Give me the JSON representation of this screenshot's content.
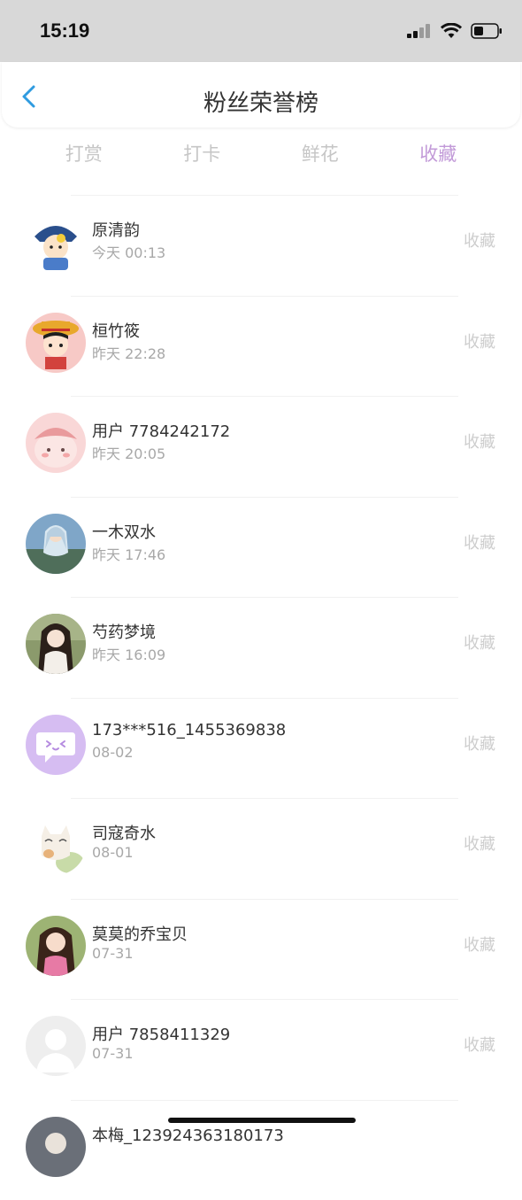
{
  "status_bar": {
    "time": "15:19"
  },
  "header": {
    "title": "粉丝荣誉榜"
  },
  "tabs": [
    {
      "label": "打赏",
      "active": false
    },
    {
      "label": "打卡",
      "active": false
    },
    {
      "label": "鲜花",
      "active": false
    },
    {
      "label": "收藏",
      "active": true
    }
  ],
  "accent_color": "#c29ad8",
  "list": [
    {
      "name": "原清韵",
      "time": "今天 00:13",
      "action": "收藏"
    },
    {
      "name": "桓竹筱",
      "time": "昨天 22:28",
      "action": "收藏"
    },
    {
      "name": "用户 7784242172",
      "time": "昨天 20:05",
      "action": "收藏"
    },
    {
      "name": "一木双水",
      "time": "昨天 17:46",
      "action": "收藏"
    },
    {
      "name": "芍药梦境",
      "time": "昨天 16:09",
      "action": "收藏"
    },
    {
      "name": "173***516_1455369838",
      "time": "08-02",
      "action": "收藏"
    },
    {
      "name": "司寇奇水",
      "time": "08-01",
      "action": "收藏"
    },
    {
      "name": "莫莫的乔宝贝",
      "time": "07-31",
      "action": "收藏"
    },
    {
      "name": "用户 7858411329",
      "time": "07-31",
      "action": "收藏"
    },
    {
      "name": "本梅_123924363180173",
      "time": "",
      "action": ""
    }
  ]
}
